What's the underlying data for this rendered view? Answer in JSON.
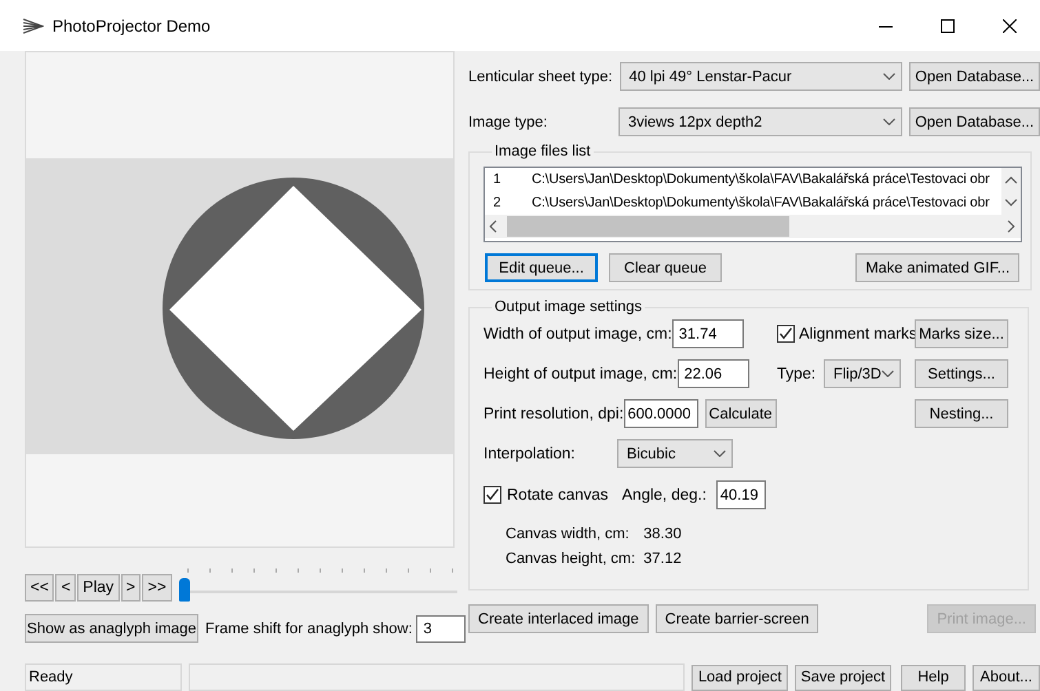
{
  "window": {
    "title": "PhotoProjector Demo"
  },
  "player": {
    "buttons": [
      "<<",
      "<",
      "Play",
      ">",
      ">>"
    ],
    "frame_slider": {
      "level": 0
    }
  },
  "anaglyph": {
    "button": "Show as anaglyph image",
    "frame_shift_label": "Frame shift for anaglyph show:",
    "frame_shift": "3"
  },
  "sheet_type": {
    "label": "Lenticular sheet type:",
    "value": "40 lpi 49° Lenstar-Pacur",
    "button": "Open Database..."
  },
  "image_type": {
    "label": "Image type:",
    "value": "3views 12px depth2",
    "button": "Open Database..."
  },
  "image_files": {
    "title": "Image files list",
    "rows": [
      {
        "index": "1",
        "path": "C:\\Users\\Jan\\Desktop\\Dokumenty\\škola\\FAV\\Bakalářská práce\\Testovaci obr"
      },
      {
        "index": "2",
        "path": "C:\\Users\\Jan\\Desktop\\Dokumenty\\škola\\FAV\\Bakalářská práce\\Testovaci obr"
      }
    ],
    "buttons": [
      {
        "label": "Edit queue...",
        "focused": true
      },
      {
        "label": "Clear queue",
        "focused": false
      },
      {
        "label": "Make animated GIF...",
        "focused": false
      }
    ]
  },
  "output_settings": {
    "title": "Output image settings",
    "width": {
      "label": "Width of output image,  cm:",
      "value": "31.74"
    },
    "height": {
      "label": "Height of output image, cm:",
      "value": "22.06"
    },
    "resolution": {
      "label": "Print resolution, dpi:",
      "value": "600.0000",
      "button": "Calculate"
    },
    "interpolation": {
      "label": "Interpolation:",
      "value": "Bicubic"
    },
    "rotate_canvas": {
      "label": "Rotate canvas",
      "checked": true
    },
    "angle": {
      "label": "Angle, deg.:",
      "value": "40.19"
    },
    "canvas_width": {
      "label": "Canvas width,  cm:",
      "value": "38.30"
    },
    "canvas_height": {
      "label": "Canvas height, cm:",
      "value": "37.12"
    },
    "alignment_marks": {
      "label": "Alignment marks",
      "checked": true
    },
    "marks_size_button": "Marks size...",
    "type": {
      "label": "Type:",
      "value": "Flip/3D"
    },
    "settings_button": "Settings...",
    "nesting_button": "Nesting..."
  },
  "actions": [
    {
      "label": "Create interlaced image",
      "disabled": false
    },
    {
      "label": "Create barrier-screen",
      "disabled": false
    },
    {
      "label": "Print image...",
      "disabled": true
    }
  ],
  "status_bar": {
    "status": "Ready",
    "buttons": [
      "Load project",
      "Save project",
      "Help",
      "About..."
    ]
  }
}
